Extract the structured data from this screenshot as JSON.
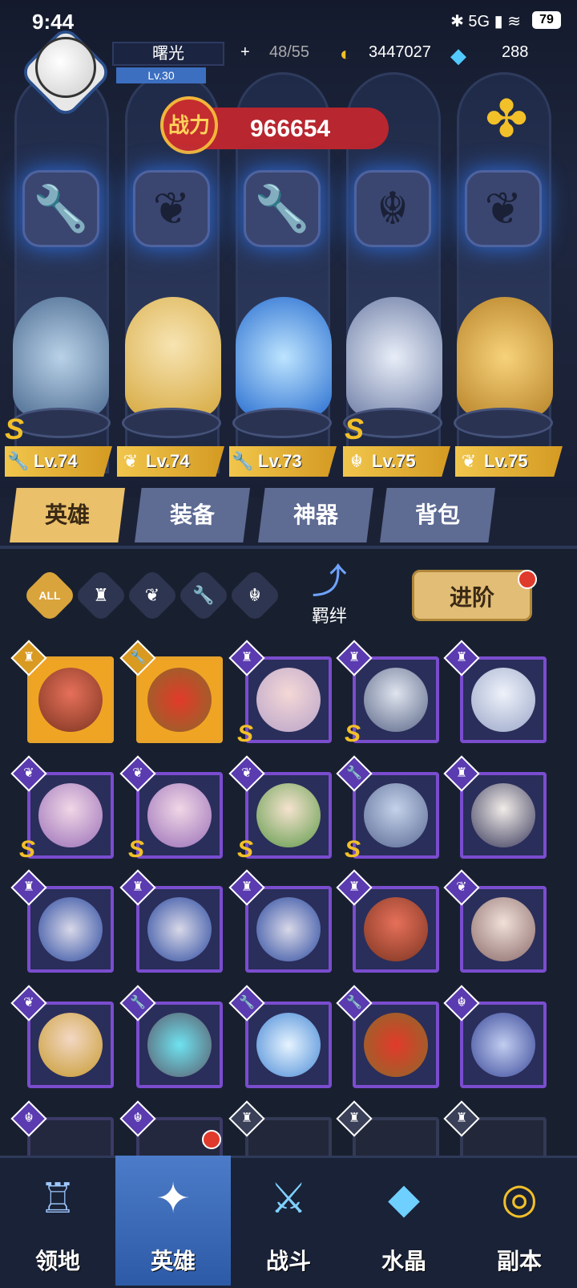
{
  "status_bar": {
    "time": "9:44",
    "battery": "79",
    "signal": "5G"
  },
  "player": {
    "name": "曙光",
    "level": "Lv.30"
  },
  "resources": {
    "stamina": "48/55",
    "gold": "3447027",
    "gems": "288"
  },
  "power": {
    "label": "战力",
    "value": "966654"
  },
  "heroes": [
    {
      "level": "Lv.74",
      "rank": "S",
      "class_icon": "wrench-icon"
    },
    {
      "level": "Lv.74",
      "rank": "",
      "class_icon": "wing-icon"
    },
    {
      "level": "Lv.73",
      "rank": "",
      "class_icon": "wrench-icon"
    },
    {
      "level": "Lv.75",
      "rank": "S",
      "class_icon": "demon-icon"
    },
    {
      "level": "Lv.75",
      "rank": "",
      "class_icon": "wing-icon"
    }
  ],
  "tabs": [
    {
      "label": "英雄",
      "active": true
    },
    {
      "label": "装备",
      "active": false
    },
    {
      "label": "神器",
      "active": false
    },
    {
      "label": "背包",
      "active": false
    }
  ],
  "filters": {
    "all_label": "ALL"
  },
  "bond": {
    "label": "羁绊"
  },
  "advance_button": {
    "label": "进阶"
  },
  "nav": [
    {
      "label": "领地",
      "active": false
    },
    {
      "label": "英雄",
      "active": true
    },
    {
      "label": "战斗",
      "active": false
    },
    {
      "label": "水晶",
      "active": false
    },
    {
      "label": "副本",
      "active": false
    }
  ],
  "colors": {
    "accent": "#eac06a",
    "panel_bg": "#18202f",
    "power_red": "#b8262f"
  }
}
